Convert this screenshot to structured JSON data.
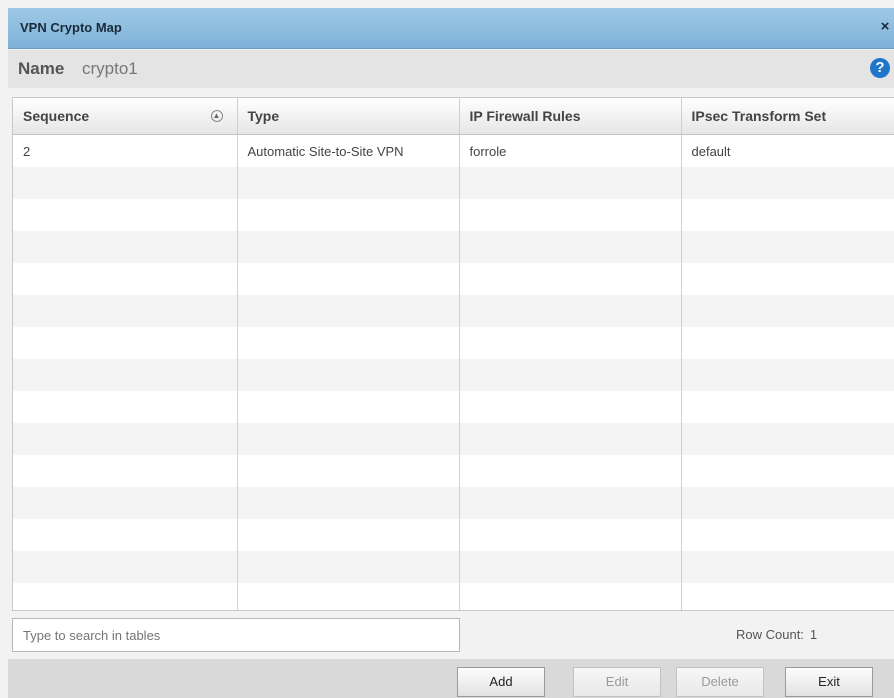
{
  "dialog": {
    "title": "VPN Crypto Map",
    "close_icon": "close-icon"
  },
  "name": {
    "label": "Name",
    "value": "crypto1",
    "help_icon": "help-icon"
  },
  "table": {
    "columns": [
      "Sequence",
      "Type",
      "IP Firewall Rules",
      "IPsec Transform Set"
    ],
    "rows": [
      [
        "2",
        "Automatic Site-to-Site VPN",
        "forrole",
        "default"
      ]
    ]
  },
  "search": {
    "placeholder": "Type to search in tables"
  },
  "row_count": {
    "label": "Row Count:",
    "value": "1"
  },
  "buttons": {
    "add": "Add",
    "edit": "Edit",
    "delete": "Delete",
    "exit": "Exit"
  }
}
